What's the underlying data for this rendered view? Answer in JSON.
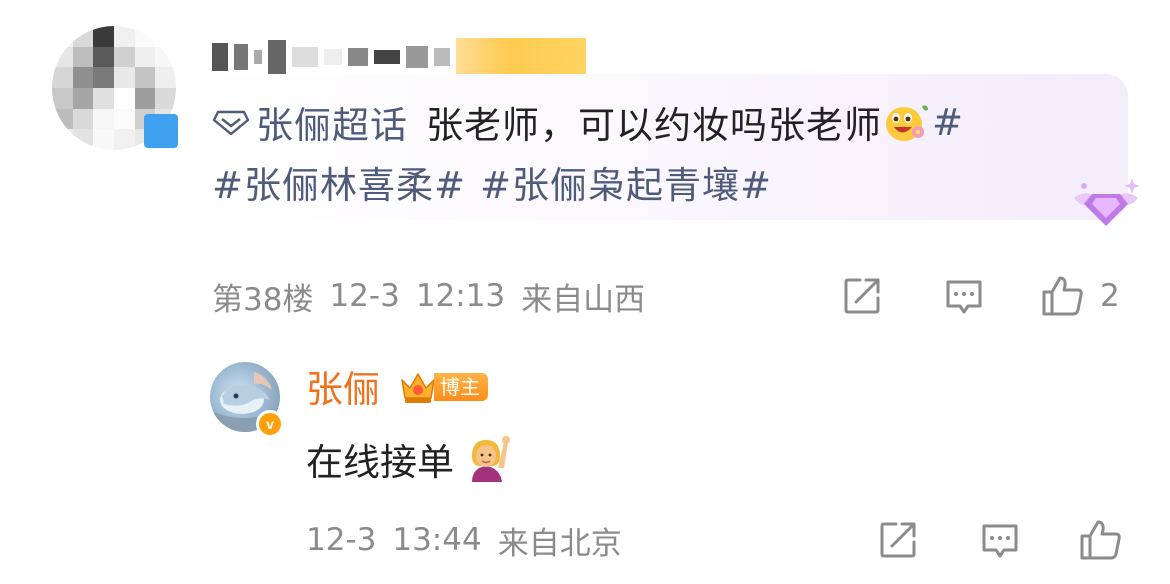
{
  "comment": {
    "topic_label": "张俪超话",
    "text": "张老师，可以约妆吗张老师",
    "topics_line2": [
      "#张俪林喜柔#",
      "#张俪枭起青壤#"
    ],
    "topic_suffix": "#",
    "floor": "第38楼",
    "date": "12-3",
    "time": "12:13",
    "location": "来自山西",
    "like_count": "2",
    "icons": {
      "topic": "super-topic-diamond-icon",
      "share": "share-icon",
      "comment": "comment-icon",
      "like": "thumbs-up-icon"
    }
  },
  "reply": {
    "author": "张俪",
    "author_badge": "博主",
    "verified_mark": "v",
    "text": "在线接单",
    "date": "12-3",
    "time": "13:44",
    "location": "来自北京"
  },
  "colors": {
    "topic_text": "#4f5b7a",
    "meta_text": "#8b8b8b",
    "author_name": "#f2711c",
    "badge_orange": "#ff8c1a",
    "verified_badge": "#ff9f0a",
    "bubble_tint": "#f3ecfb"
  }
}
